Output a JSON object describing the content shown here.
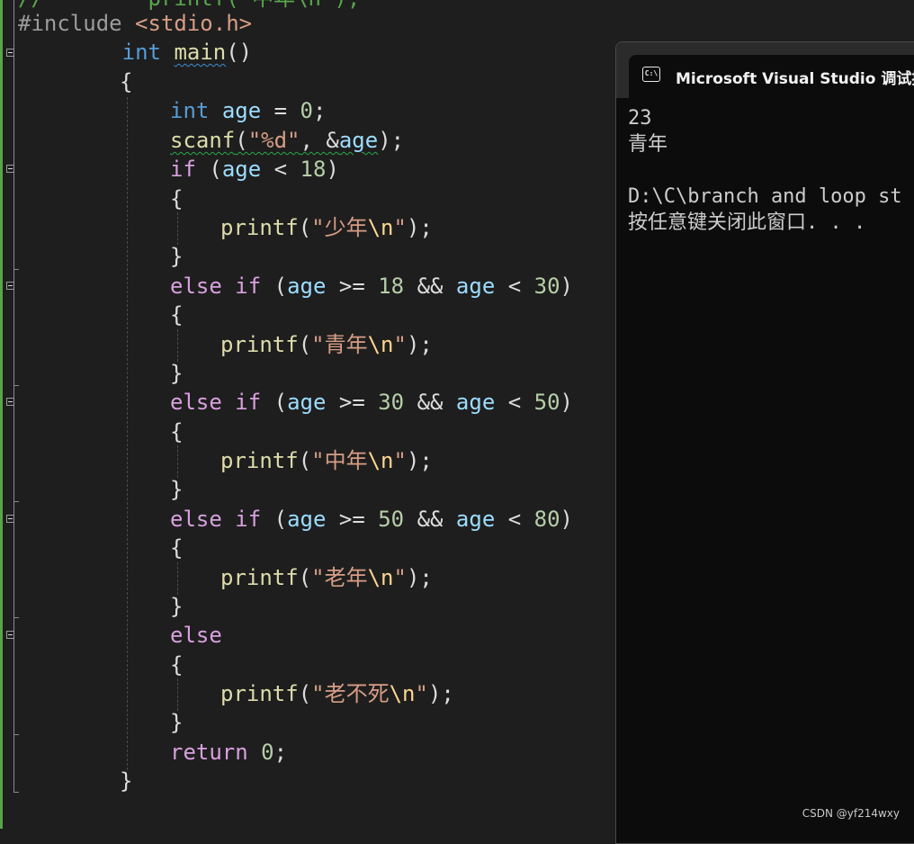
{
  "editor": {
    "partial_top_line": "//        printf(\"中年\\n\");",
    "include_directive": "#include",
    "include_header": " <stdio.h>",
    "kw_int": "int",
    "kw_if": "if",
    "kw_else": "else",
    "kw_return": "return",
    "fn_main": "main",
    "fn_scanf": "scanf",
    "fn_printf": "printf",
    "var_age": "age",
    "num_0": "0",
    "num_18": "18",
    "num_30": "30",
    "num_50": "50",
    "num_80": "80",
    "fmt_d": "\"%d\"",
    "str_youth": "少年",
    "str_young": "青年",
    "str_middle": "中年",
    "str_old": "老年",
    "str_immortal": "老不死",
    "esc_newline": "\\n",
    "quote": "\"",
    "punct": {
      "parens": "()",
      "open_brace": "{",
      "close_brace": "}",
      "open_paren": "(",
      "close_paren": ")",
      "paren_semi": ");",
      "semi": ";",
      "assign": " = ",
      "comma_amp": ", &",
      "lt": " < ",
      "gte": " >= ",
      "and": " && ",
      "space": " "
    }
  },
  "console": {
    "window_title": "Microsoft Visual Studio 调试控制台",
    "icon_label": "C:\\",
    "lines": [
      "23",
      "青年",
      "",
      "D:\\C\\branch and loop st",
      "按任意键关闭此窗口. . ."
    ]
  },
  "watermark": "CSDN @yf214wxy",
  "colors": {
    "editor_background": "#1e1e1e",
    "keyword_blue": "#569cd6",
    "keyword_purple": "#d8a0df",
    "function": "#dcdcaa",
    "variable": "#9cdcfe",
    "number": "#b5cea8",
    "string": "#d69d85",
    "escape": "#ffd68f",
    "console_background": "#0c0c0c"
  }
}
